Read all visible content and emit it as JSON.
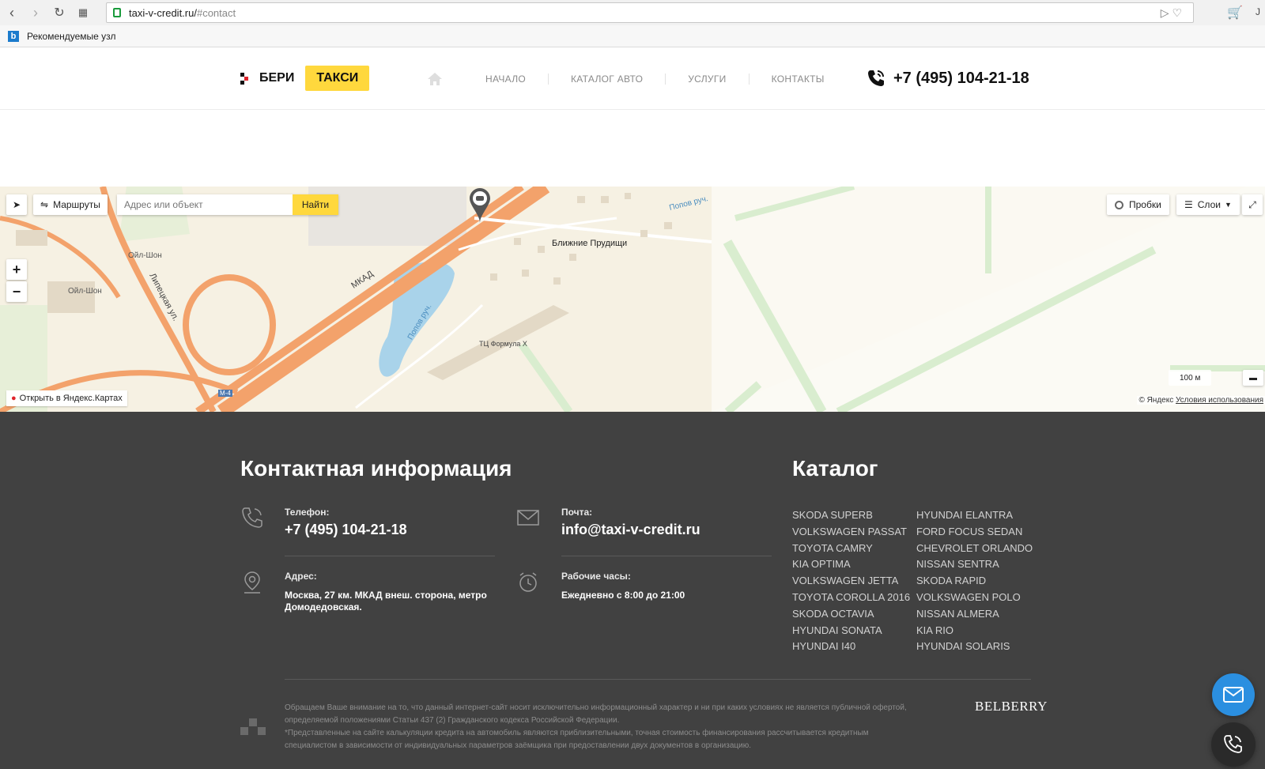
{
  "browser": {
    "url_host": "taxi-v-credit.ru/",
    "url_fragment": "#contact",
    "bookmark_label": "Рекомендуемые узл"
  },
  "header": {
    "logo_word": "БЕРИ",
    "logo_pill": "ТАКСИ",
    "nav": [
      "НАЧАЛО",
      "КАТАЛОГ АВТО",
      "УСЛУГИ",
      "КОНТАКТЫ"
    ],
    "phone": "+7 (495) 104-21-18"
  },
  "map": {
    "routes_label": "Маршруты",
    "search_placeholder": "Адрес или объект",
    "find_label": "Найти",
    "traffic_label": "Пробки",
    "layers_label": "Слои",
    "open_label": "Открыть в Яндекс.Картах",
    "scale_label": "100 м",
    "copyright": "© Яндекс",
    "terms": "Условия использования",
    "labels": {
      "mkad": "МКАД",
      "lipetskaya": "Липецкая ул.",
      "blizhnie": "Ближние Прудищи",
      "formula": "ТЦ Формула Х",
      "stream1": "Попов руч.",
      "stream2": "Попов руч.",
      "oil1": "Ойл-Шон",
      "oil2": "Ойл-Шон",
      "m4": "М-4"
    }
  },
  "contacts": {
    "title": "Контактная информация",
    "phone_label": "Телефон:",
    "phone_value": "+7 (495) 104-21-18",
    "mail_label": "Почта:",
    "mail_value": "info@taxi-v-credit.ru",
    "address_label": "Адрес:",
    "address_line1": "Москва, 27 км. МКАД внеш. сторона, метро",
    "address_line2": "Домодедовская.",
    "hours_label": "Рабочие часы:",
    "hours_value": "Ежедневно с 8:00 до 21:00"
  },
  "catalog": {
    "title": "Каталог",
    "col1": [
      "SKODA SUPERB",
      "VOLKSWAGEN PASSAT",
      "TOYOTA CAMRY",
      "KIA OPTIMA",
      "VOLKSWAGEN JETTA",
      "TOYOTA COROLLA 2016",
      "SKODA OCTAVIA",
      "HYUNDAI SONATA",
      "HYUNDAI I40"
    ],
    "col2": [
      "HYUNDAI ELANTRA",
      "FORD FOCUS SEDAN",
      "CHEVROLET ORLANDO",
      "NISSAN SENTRA",
      "SKODA RAPID",
      "VOLKSWAGEN POLO",
      "NISSAN ALMERA",
      "KIA RIO",
      "HYUNDAI SOLARIS"
    ]
  },
  "disclaimer": {
    "line1": "Обращаем Ваше внимание на то, что данный интернет-сайт носит исключительно информационный характер и ни при каких условиях не является публичной офертой,",
    "line2": "определяемой положениями Статьи 437 (2) Гражданского кодекса Российской Федерации.",
    "line3": "*Представленные на сайте калькуляции кредита на автомобиль являются приблизительными, точная стоимость финансирования рассчитывается кредитным",
    "line4": "специалистом в зависимости от индивидуальных параметров заёмщика при предоставлении двух документов в организацию."
  },
  "developer": "BELBERRY",
  "colors": {
    "accent_yellow": "#ffd83d",
    "footer_bg": "#414141",
    "fab_blue": "#2b8fe0"
  }
}
